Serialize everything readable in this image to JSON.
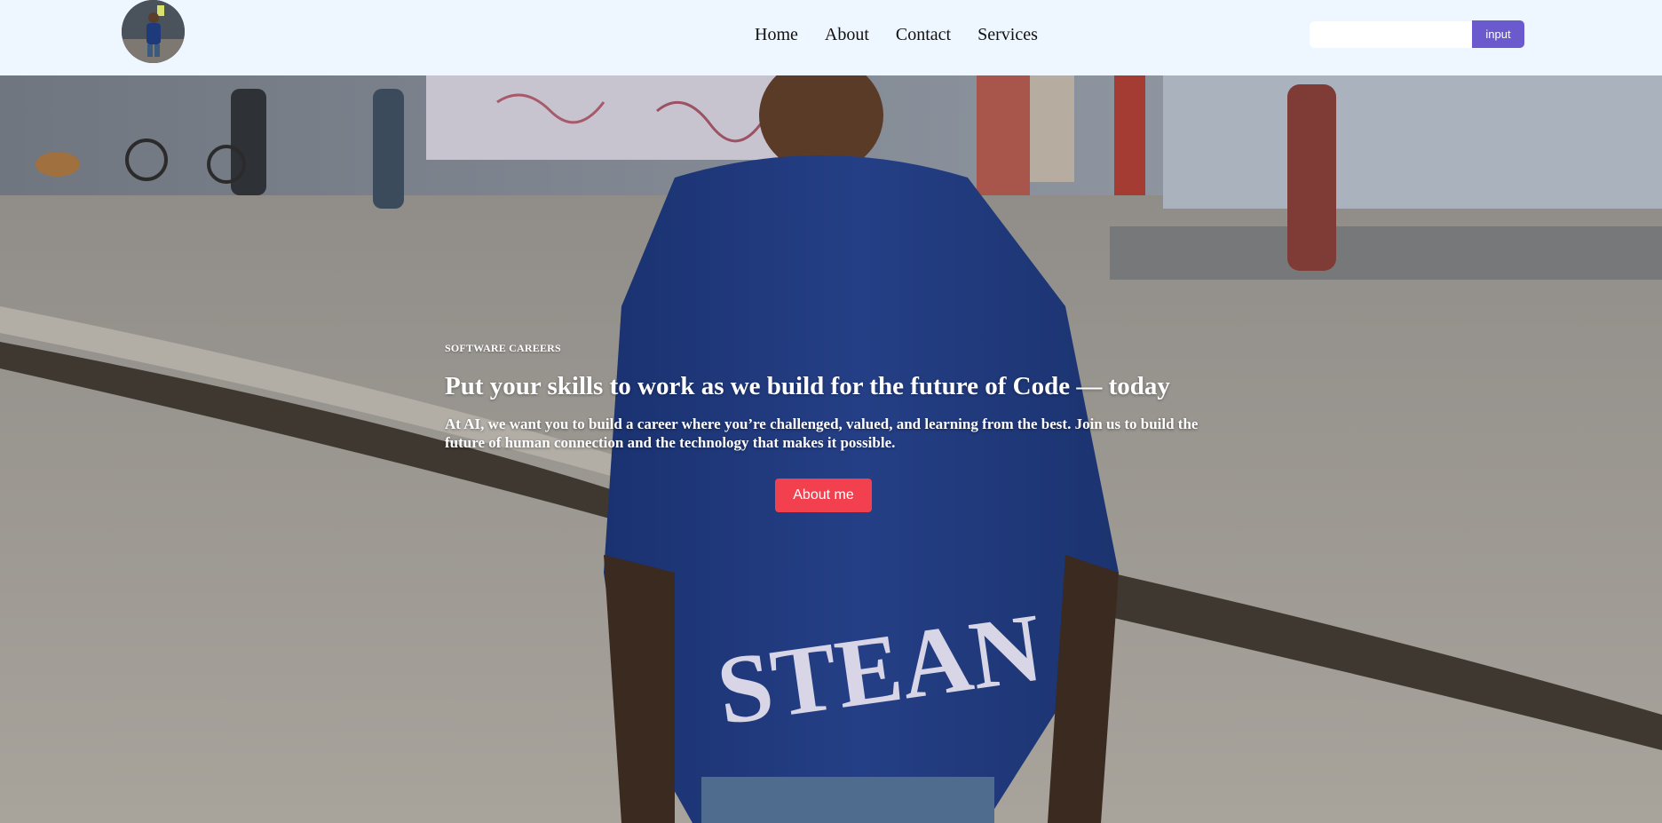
{
  "nav": {
    "logo_alt": "profile avatar",
    "links": [
      {
        "label": "Home"
      },
      {
        "label": "About"
      },
      {
        "label": "Contact"
      },
      {
        "label": "Services"
      }
    ],
    "search": {
      "placeholder": "",
      "value": "",
      "button_label": "input"
    }
  },
  "hero": {
    "eyebrow": "SOFTWARE CAREERS",
    "headline": "Put your skills to work as we build for the future of Code — today",
    "subtext": "At AI, we want you to build a career where you’re challenged, valued, and learning from the best. Join us to build the future of human connection and the technology that makes it possible.",
    "cta_label": "About me",
    "shirt_text": "STEAN"
  },
  "colors": {
    "nav_bg": "#eef7ff",
    "search_button": "#6a5acd",
    "cta": "#f2404f",
    "shirt": "#1f3a7a"
  },
  "icons": {
    "logo": "avatar-photo"
  }
}
